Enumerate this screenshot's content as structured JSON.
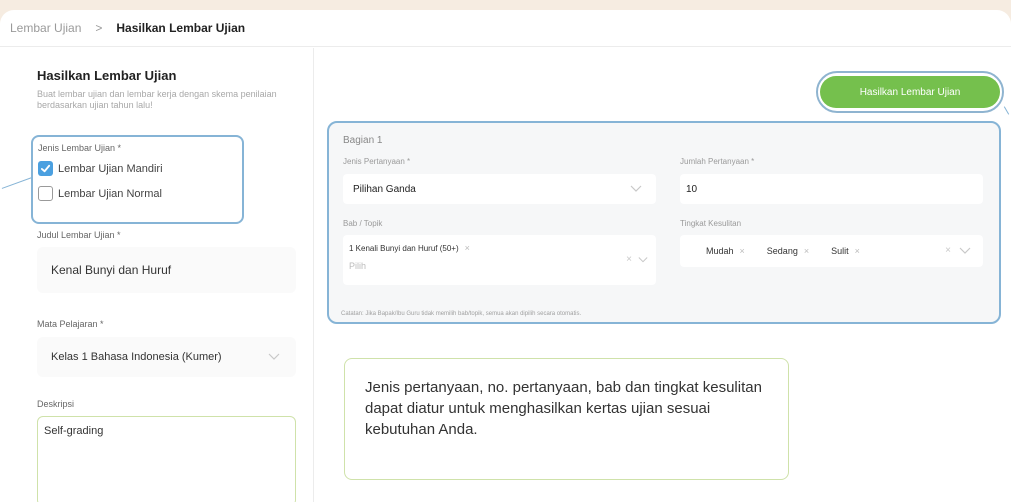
{
  "breadcrumb": {
    "parent": "Lembar Ujian",
    "separator": ">",
    "current": "Hasilkan Lembar Ujian"
  },
  "form": {
    "title": "Hasilkan Lembar Ujian",
    "subtitle": "Buat lembar ujian dan lembar kerja dengan skema penilaian berdasarkan ujian tahun lalu!",
    "type_label": "Jenis Lembar Ujian *",
    "type_options": [
      {
        "label": "Lembar Ujian Mandiri",
        "checked": true
      },
      {
        "label": "Lembar Ujian Normal",
        "checked": false
      }
    ],
    "title_label": "Judul Lembar Ujian *",
    "title_value": "Kenal Bunyi dan Huruf",
    "subject_label": "Mata Pelajaran *",
    "subject_value": "Kelas 1 Bahasa Indonesia (Kumer)",
    "description_label": "Deskripsi",
    "description_value": "Self-grading"
  },
  "generate_button": "Hasilkan Lembar Ujian",
  "section": {
    "title": "Bagian 1",
    "question_type_label": "Jenis Pertanyaan *",
    "question_type_value": "Pilihan Ganda",
    "question_count_label": "Jumlah Pertanyaan *",
    "question_count_value": "10",
    "topic_label": "Bab / Topik",
    "topic_tag": "1 Kenali Bunyi dan Huruf (50+)",
    "topic_placeholder": "Pilih",
    "difficulty_label": "Tingkat Kesulitan",
    "difficulty_tags": [
      "Mudah",
      "Sedang",
      "Sulit"
    ],
    "note": "Catatan: Jika Bapak/Ibu Guru tidak memilih bab/topik, semua akan dipilih secara otomatis."
  },
  "tooltip": "Jenis pertanyaan, no. pertanyaan, bab dan tingkat kesulitan dapat diatur untuk menghasilkan kertas ujian sesuai kebutuhan Anda.",
  "colors": {
    "accent_green": "#75c04d",
    "highlight_blue": "#86b4d6",
    "checkbox_blue": "#4ba0e0"
  }
}
